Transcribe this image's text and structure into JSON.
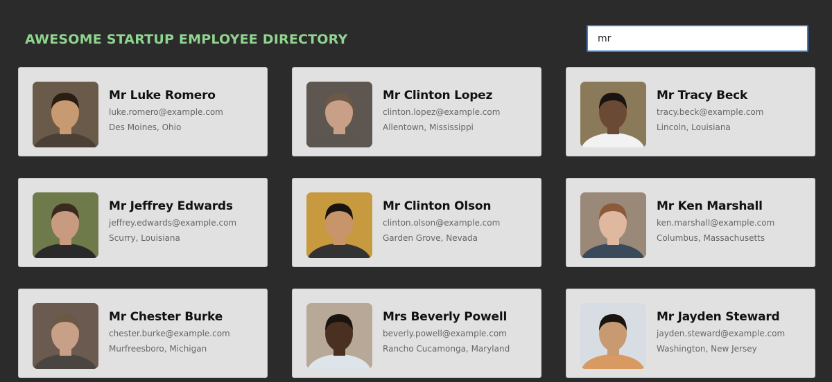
{
  "header": {
    "title": "AWESOME STARTUP EMPLOYEE DIRECTORY",
    "search_value": "mr"
  },
  "colors": {
    "background": "#2b2b2b",
    "title": "#8fd48f",
    "card": "#e1e1e1",
    "search_border": "#2f7fd6"
  },
  "employees": [
    {
      "name": "Mr Luke Romero",
      "email": "luke.romero@example.com",
      "location": "Des Moines, Ohio",
      "photo": {
        "bg": "#6a5a4a",
        "skin": "#c89a72",
        "hair": "#2a1d14",
        "shirt": "#4a4036"
      }
    },
    {
      "name": "Mr Clinton Lopez",
      "email": "clinton.lopez@example.com",
      "location": "Allentown, Mississippi",
      "photo": {
        "bg": "#5e5650",
        "skin": "#c8a088",
        "hair": "#6b5845",
        "shirt": "#5c5650"
      }
    },
    {
      "name": "Mr Tracy Beck",
      "email": "tracy.beck@example.com",
      "location": "Lincoln, Louisiana",
      "photo": {
        "bg": "#8a7a5a",
        "skin": "#6b4a35",
        "hair": "#1a1410",
        "shirt": "#f2f2f2"
      }
    },
    {
      "name": "Mr Jeffrey Edwards",
      "email": "jeffrey.edwards@example.com",
      "location": "Scurry, Louisiana",
      "photo": {
        "bg": "#6f7a4a",
        "skin": "#c89a80",
        "hair": "#3a2a20",
        "shirt": "#2a2a2a"
      }
    },
    {
      "name": "Mr Clinton Olson",
      "email": "clinton.olson@example.com",
      "location": "Garden Grove, Nevada",
      "photo": {
        "bg": "#c89a40",
        "skin": "#c8946a",
        "hair": "#1a1410",
        "shirt": "#333333"
      }
    },
    {
      "name": "Mr Ken Marshall",
      "email": "ken.marshall@example.com",
      "location": "Columbus, Massachusetts",
      "photo": {
        "bg": "#9a8878",
        "skin": "#e0b8a0",
        "hair": "#8a5a3a",
        "shirt": "#3a4a5a"
      }
    },
    {
      "name": "Mr Chester Burke",
      "email": "chester.burke@example.com",
      "location": "Murfreesboro, Michigan",
      "photo": {
        "bg": "#6a5a50",
        "skin": "#c8a088",
        "hair": "#6b5845",
        "shirt": "#4a4540"
      }
    },
    {
      "name": "Mrs Beverly Powell",
      "email": "beverly.powell@example.com",
      "location": "Rancho Cucamonga, Maryland",
      "photo": {
        "bg": "#b8a898",
        "skin": "#4a3020",
        "hair": "#1a1410",
        "shirt": "#dde4ea"
      }
    },
    {
      "name": "Mr Jayden Steward",
      "email": "jayden.steward@example.com",
      "location": "Washington, New Jersey",
      "photo": {
        "bg": "#d8dde4",
        "skin": "#c89a72",
        "hair": "#1a1410",
        "shirt": "#d89a60"
      }
    }
  ]
}
